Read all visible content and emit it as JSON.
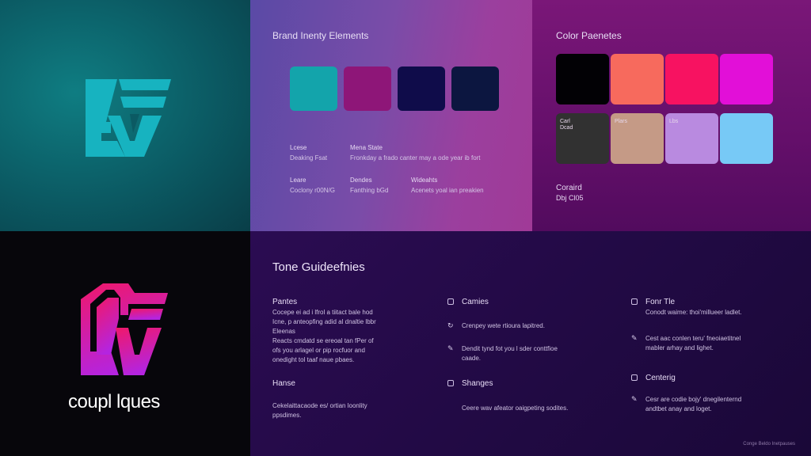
{
  "brand": {
    "name": "coupl lques"
  },
  "identity": {
    "title": "Brand Inenty Elements",
    "swatches": [
      "#13a4ab",
      "#8e1678",
      "#0f0c4a",
      "#0c1640"
    ],
    "rows": [
      {
        "label": "Lcese",
        "value": "Deaking Fsat"
      },
      {
        "label": "Mena State",
        "value": "Fronkday a frado canter may a ode year ib fort"
      },
      {
        "label": "Leare",
        "value": "Coclony r00N/G"
      },
      {
        "label": "Dendes",
        "value": "Fanthing bGd"
      },
      {
        "label": "Wideahts",
        "value": "Acenets yoal ian preakien"
      }
    ]
  },
  "palette": {
    "title": "Color Paenetes",
    "row1": [
      "#020105",
      "#f76a5d",
      "#f71261",
      "#e20fd8"
    ],
    "row2": [
      {
        "color": "#313131",
        "label": "Carl\nDcad"
      },
      {
        "color": "#c59a86",
        "label": "Plars"
      },
      {
        "color": "#b98ae0",
        "label": "Lbs"
      },
      {
        "color": "#77c9f6",
        "label": ""
      }
    ],
    "note_line1": "Coraird",
    "note_line2": "Dbj Cl05"
  },
  "tone": {
    "title": "Tone Guideefnies",
    "col1": {
      "h1": "Pantes",
      "t1": [
        "Cocepe ei ad i lfrol a tiitact bale hod",
        "Icne, p anteopfing adid al dnaltie lbbr",
        "Eleenas",
        "Reacts cmdatd se ereoal tan fPer of",
        "ofs you arlagel or pip rocfuor and",
        "onedight tol taaf naue pbaes."
      ],
      "h2": "Hanse",
      "t2": [
        "Cekelaittacaode es/ ortian loonlity",
        "ppsdimes."
      ]
    },
    "col2": {
      "h1": "Camies",
      "t1": [
        "Crenpey wete rtioura lapitred."
      ],
      "t2": [
        "Dendit tynd fot you l sder conttfioe",
        "caade."
      ],
      "h2": "Shanges",
      "t3": [
        "Ceere wav afeator oaigpeting sodites."
      ]
    },
    "col3": {
      "h1": "Fonr Tle",
      "t1": [
        "Conodt waime: thoi'millueer ladlet."
      ],
      "t2": [
        "Cest aac conlen teru' fneoiaetitnel",
        "mabler arhay and lighet."
      ],
      "h2": "Centerig",
      "t3": [
        "Cesr are codie bojy' dnegilenternd",
        "andtbet anay and loget."
      ]
    },
    "footer": "Conge Beldo Inetpauses"
  },
  "colors": {
    "teal_logo": "#17b3c0",
    "magenta_logo_top": "#f0186a",
    "magenta_logo_bottom": "#b424e0"
  }
}
